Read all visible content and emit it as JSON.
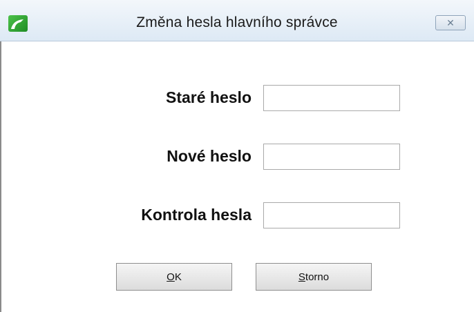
{
  "window": {
    "title": "Změna hesla hlavního správce",
    "close_glyph": "✕",
    "app_icon": "app-logo-icon",
    "close_icon": "close-icon"
  },
  "form": {
    "fields": [
      {
        "label": "Staré heslo",
        "value": "",
        "placeholder": ""
      },
      {
        "label": "Nové heslo",
        "value": "",
        "placeholder": ""
      },
      {
        "label": "Kontrola hesla",
        "value": "",
        "placeholder": ""
      }
    ]
  },
  "buttons": {
    "ok": {
      "mnemonic": "O",
      "rest": "K"
    },
    "cancel": {
      "mnemonic": "S",
      "rest": "torno"
    }
  },
  "colors": {
    "title_bar": "#dde9f5",
    "app_icon": "#2fa532"
  }
}
